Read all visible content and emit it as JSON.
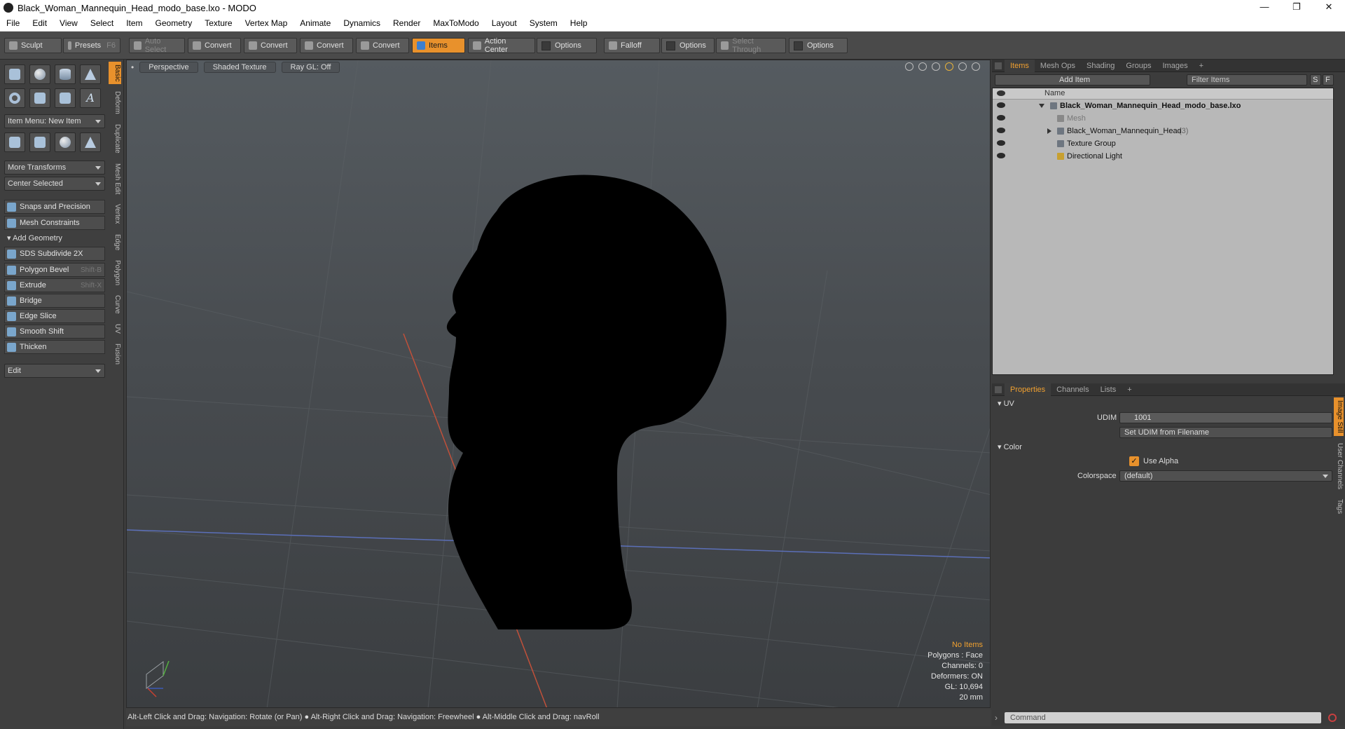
{
  "window": {
    "title": "Black_Woman_Mannequin_Head_modo_base.lxo - MODO",
    "controls": [
      "—",
      "❐",
      "✕"
    ]
  },
  "menu": [
    "File",
    "Edit",
    "View",
    "Select",
    "Item",
    "Geometry",
    "Texture",
    "Vertex Map",
    "Animate",
    "Dynamics",
    "Render",
    "MaxToModo",
    "Layout",
    "System",
    "Help"
  ],
  "toolbar": {
    "sculpt": "Sculpt",
    "presets": "Presets",
    "presets_key": "F6",
    "auto_select": "Auto Select",
    "convert1": "Convert",
    "convert2": "Convert",
    "convert3": "Convert",
    "convert4": "Convert",
    "items": "Items",
    "action_center": "Action Center",
    "options1": "Options",
    "falloff": "Falloff",
    "options2": "Options",
    "select_through": "Select Through",
    "options3": "Options"
  },
  "left_panel": {
    "item_menu": "Item Menu: New Item",
    "more_transforms": "More Transforms",
    "center_selected": "Center Selected",
    "snaps": "Snaps and Precision",
    "mesh_constraints": "Mesh Constraints",
    "add_geometry": "Add Geometry",
    "tools": [
      {
        "label": "SDS Subdivide 2X",
        "shortcut": ""
      },
      {
        "label": "Polygon Bevel",
        "shortcut": "Shift-B"
      },
      {
        "label": "Extrude",
        "shortcut": "Shift-X"
      },
      {
        "label": "Bridge",
        "shortcut": ""
      },
      {
        "label": "Edge Slice",
        "shortcut": ""
      },
      {
        "label": "Smooth Shift",
        "shortcut": ""
      },
      {
        "label": "Thicken",
        "shortcut": ""
      }
    ],
    "edit": "Edit",
    "vtabs": [
      "Basic",
      "Deform",
      "Duplicate",
      "Mesh Edit",
      "Vertex",
      "Edge",
      "Polygon",
      "Curve",
      "UV",
      "Fusion"
    ]
  },
  "viewport": {
    "view": "Perspective",
    "shading": "Shaded Texture",
    "raygl": "Ray GL: Off",
    "stats": {
      "no_items": "No Items",
      "polygons": "Polygons : Face",
      "channels": "Channels: 0",
      "deformers": "Deformers: ON",
      "gl": "GL: 10,694",
      "scale": "20 mm"
    }
  },
  "statusbar": "Alt-Left Click and Drag: Navigation: Rotate (or Pan) ● Alt-Right Click and Drag: Navigation: Freewheel ● Alt-Middle Click and Drag: navRoll",
  "items_panel": {
    "tabs": [
      "Items",
      "Mesh Ops",
      "Shading",
      "Groups",
      "Images",
      "+"
    ],
    "add_item": "Add Item",
    "filter": "Filter Items",
    "filter_s": "S",
    "filter_f": "F",
    "name_col": "Name",
    "rows": [
      {
        "label": "Black_Woman_Mannequin_Head_modo_base.lxo",
        "suffix": ""
      },
      {
        "label": "Mesh",
        "suffix": ""
      },
      {
        "label": "Black_Woman_Mannequin_Head",
        "suffix": "(3)"
      },
      {
        "label": "Texture Group",
        "suffix": ""
      },
      {
        "label": "Directional Light",
        "suffix": ""
      }
    ]
  },
  "properties_panel": {
    "tabs": [
      "Properties",
      "Channels",
      "Lists",
      "+"
    ],
    "uv_group": "UV",
    "udim_label": "UDIM",
    "udim_value": "1001",
    "set_udim": "Set UDIM from Filename",
    "color_group": "Color",
    "use_alpha": "Use Alpha",
    "colorspace_label": "Colorspace",
    "colorspace_value": "(default)",
    "side_tabs": [
      "Image Still",
      "User Channels",
      "Tags"
    ]
  },
  "command": {
    "placeholder": "Command"
  },
  "colors": {
    "accent": "#e8912c",
    "viewport_bg": "#4a4e52",
    "head": "#000000"
  }
}
